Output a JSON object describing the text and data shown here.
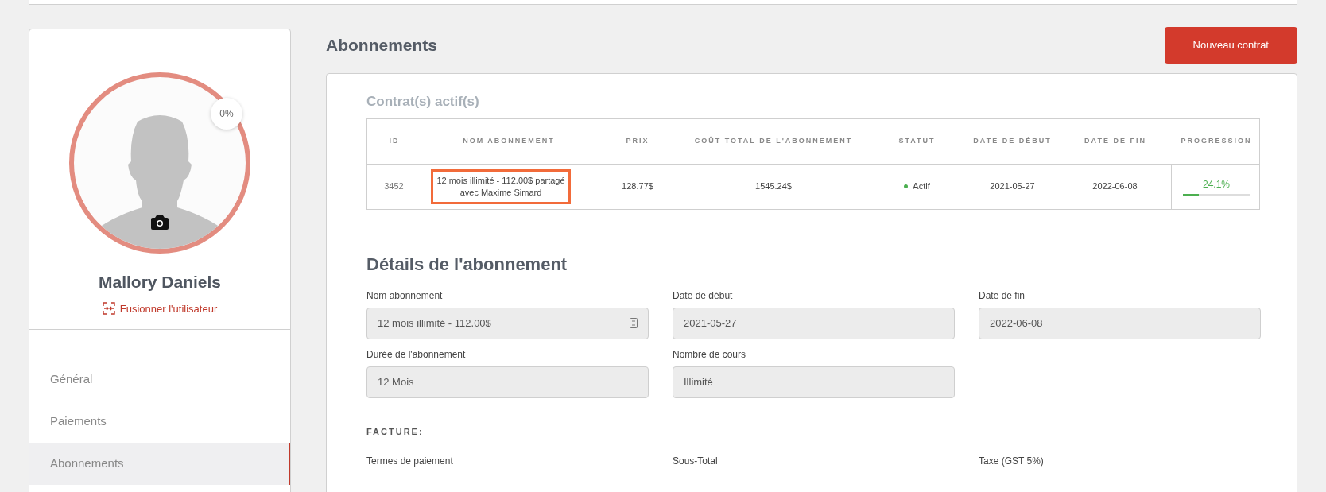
{
  "profile": {
    "completion": "0%",
    "name": "Mallory Daniels",
    "merge_link": "Fusionner l'utilisateur"
  },
  "sidebar": {
    "items": [
      {
        "label": "Général",
        "selected": false
      },
      {
        "label": "Paiements",
        "selected": false
      },
      {
        "label": "Abonnements",
        "selected": true
      }
    ]
  },
  "page": {
    "title": "Abonnements",
    "new_button": "Nouveau contrat"
  },
  "contracts": {
    "title": "Contrat(s) actif(s)",
    "columns": [
      "ID",
      "NOM ABONNEMENT",
      "PRIX",
      "COÛT TOTAL DE L'ABONNEMENT",
      "STATUT",
      "DATE DE DÉBUT",
      "DATE DE FIN",
      "PROGRESSION"
    ],
    "rows": [
      {
        "id": "3452",
        "name": "12 mois illimité - 112.00$ partagé avec Maxime Simard",
        "name_highlighted": true,
        "price": "128.77$",
        "total": "1545.24$",
        "status": "Actif",
        "color": "#4caf50",
        "start": "2021-05-27",
        "end": "2022-06-08",
        "progress": "24.1%",
        "level": 0.241
      }
    ]
  },
  "details": {
    "title": "Détails de l'abonnement",
    "fields": [
      {
        "label": "Nom abonnement",
        "value": "12 mois illimité - 112.00$",
        "kind": "select"
      },
      {
        "label": "Date de début",
        "value": "2021-05-27",
        "kind": "text"
      },
      {
        "label": "Date de fin",
        "value": "2022-06-08",
        "kind": "text"
      },
      {
        "label": "Durée de l'abonnement",
        "value": "12 Mois",
        "kind": "text"
      },
      {
        "label": "Nombre de cours",
        "value": "Illimité",
        "kind": "text"
      }
    ],
    "invoice_title": "FACTURE:",
    "invoice_labels": [
      "Termes de paiement",
      "Sous-Total",
      "Taxe (GST 5%)"
    ]
  }
}
